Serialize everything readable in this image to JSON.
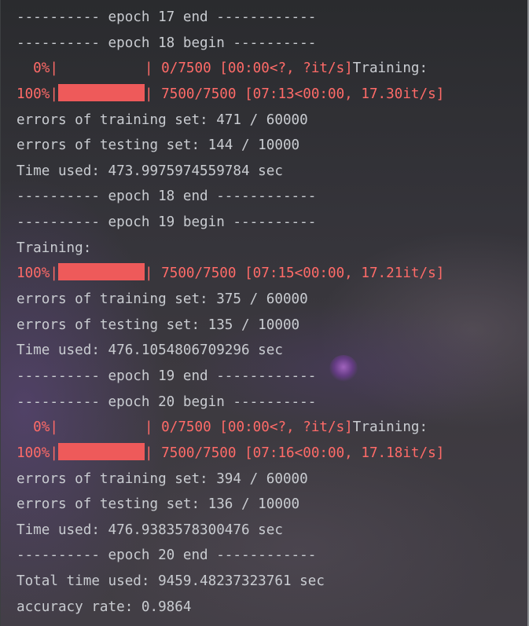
{
  "console": {
    "lines": [
      {
        "kind": "text",
        "text": "---------- epoch 17 end ------------"
      },
      {
        "kind": "text",
        "text": "---------- epoch 18 begin ----------"
      },
      {
        "kind": "progress",
        "prefix": "  0%|",
        "fill": 0,
        "suffix": "| 0/7500 [00:00<?, ?it/s]",
        "tail": "Training:"
      },
      {
        "kind": "progress",
        "prefix": "100%|",
        "fill": 1,
        "suffix": "| 7500/7500 [07:13<00:00, 17.30it/s]",
        "tail": ""
      },
      {
        "kind": "text",
        "text": "errors of training set: 471 / 60000"
      },
      {
        "kind": "text",
        "text": "errors of testing set: 144 / 10000"
      },
      {
        "kind": "text",
        "text": "Time used: 473.9975974559784 sec"
      },
      {
        "kind": "text",
        "text": "---------- epoch 18 end ------------"
      },
      {
        "kind": "text",
        "text": "---------- epoch 19 begin ----------"
      },
      {
        "kind": "text",
        "text": "Training:"
      },
      {
        "kind": "progress",
        "prefix": "100%|",
        "fill": 1,
        "suffix": "| 7500/7500 [07:15<00:00, 17.21it/s]",
        "tail": ""
      },
      {
        "kind": "text",
        "text": "errors of training set: 375 / 60000"
      },
      {
        "kind": "text",
        "text": "errors of testing set: 135 / 10000"
      },
      {
        "kind": "text",
        "text": "Time used: 476.1054806709296 sec"
      },
      {
        "kind": "text",
        "text": "---------- epoch 19 end ------------"
      },
      {
        "kind": "text",
        "text": "---------- epoch 20 begin ----------"
      },
      {
        "kind": "progress",
        "prefix": "  0%|",
        "fill": 0,
        "suffix": "| 0/7500 [00:00<?, ?it/s]",
        "tail": "Training:"
      },
      {
        "kind": "progress",
        "prefix": "100%|",
        "fill": 1,
        "suffix": "| 7500/7500 [07:16<00:00, 17.18it/s]",
        "tail": ""
      },
      {
        "kind": "text",
        "text": "errors of training set: 394 / 60000"
      },
      {
        "kind": "text",
        "text": "errors of testing set: 136 / 10000"
      },
      {
        "kind": "text",
        "text": "Time used: 476.9383578300476 sec"
      },
      {
        "kind": "text",
        "text": "---------- epoch 20 end ------------"
      },
      {
        "kind": "text",
        "text": "Total time used: 9459.48237323761 sec"
      },
      {
        "kind": "text",
        "text": "accuracy rate: 0.9864"
      }
    ]
  },
  "colors": {
    "text": "#c9ccd1",
    "progress_text": "#ff6b68",
    "progress_bar": "#ee5a5a"
  }
}
